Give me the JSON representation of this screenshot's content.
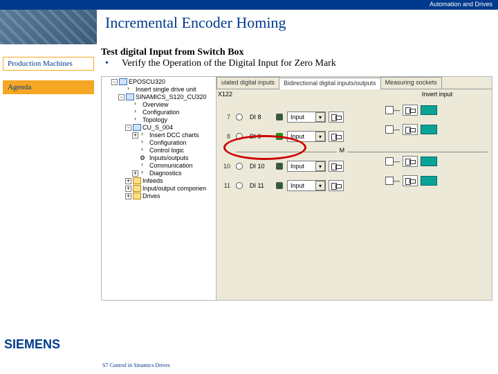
{
  "header": {
    "corp_label": "Automation and Drives"
  },
  "hero": {
    "title": "Incremental Encoder Homing"
  },
  "sidebar": {
    "items": [
      {
        "label": "Production Machines"
      },
      {
        "label": "Agenda"
      }
    ]
  },
  "content": {
    "subtitle": "Test digital Input from Switch Box",
    "bullet": "Verify the Operation of the Digital Input for Zero Mark"
  },
  "tree": {
    "root": "EPOSCU320",
    "items": [
      {
        "l": 1,
        "exp": "-",
        "icon": "blue",
        "label": "EPOSCU320"
      },
      {
        "l": 2,
        "exp": "",
        "icon": "arrow",
        "label": "Insert single drive unit"
      },
      {
        "l": 2,
        "exp": "-",
        "icon": "blue",
        "label": "SINAMICS_S120_CU320"
      },
      {
        "l": 3,
        "exp": "",
        "icon": "arrow",
        "label": "Overview"
      },
      {
        "l": 3,
        "exp": "",
        "icon": "arrow",
        "label": "Configuration"
      },
      {
        "l": 3,
        "exp": "",
        "icon": "arrow",
        "label": "Topology"
      },
      {
        "l": 3,
        "exp": "-",
        "icon": "blue",
        "label": "CU_S_004"
      },
      {
        "l": 4,
        "exp": "+",
        "icon": "arrow",
        "label": "Insert DCC charts"
      },
      {
        "l": 4,
        "exp": "",
        "icon": "arrow",
        "label": "Configuration"
      },
      {
        "l": 4,
        "exp": "",
        "icon": "arrow",
        "label": "Control logic"
      },
      {
        "l": 4,
        "exp": "",
        "icon": "gear",
        "label": "Inputs/outputs"
      },
      {
        "l": 4,
        "exp": "",
        "icon": "arrow",
        "label": "Communication"
      },
      {
        "l": 4,
        "exp": "+",
        "icon": "arrow",
        "label": "Diagnostics"
      },
      {
        "l": 3,
        "exp": "+",
        "icon": "yel",
        "label": "Infeeds"
      },
      {
        "l": 3,
        "exp": "+",
        "icon": "yel",
        "label": "Input/output componen"
      },
      {
        "l": 3,
        "exp": "+",
        "icon": "yel",
        "label": "Drives"
      }
    ]
  },
  "tabs": {
    "items": [
      {
        "label": "ulated digital inputs"
      },
      {
        "label": "Bidirectional digital inputs/outputs"
      },
      {
        "label": "Measuring sockets"
      }
    ],
    "active": 1
  },
  "io": {
    "terminal": "X122",
    "invert_label": "Invert input",
    "field_text": "Input",
    "mid_label": "M",
    "rows_top": [
      {
        "pin": "7",
        "di": "DI 8"
      },
      {
        "pin": "8",
        "di": "DI 9"
      }
    ],
    "rows_bot": [
      {
        "pin": "10",
        "di": "DI 10"
      },
      {
        "pin": "11",
        "di": "DI 11"
      }
    ]
  },
  "footer": {
    "logo": "SIEMENS",
    "left": "S7 Control in Sinamics Drives",
    "right": ""
  }
}
